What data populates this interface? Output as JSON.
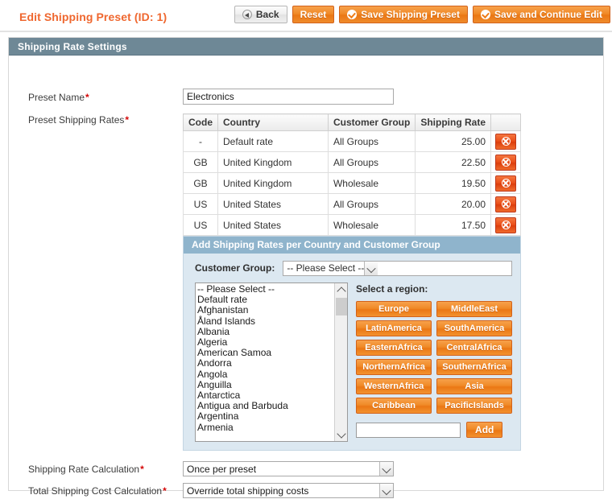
{
  "header": {
    "title": "Edit Shipping Preset (ID: 1)",
    "buttons": {
      "back": "Back",
      "reset": "Reset",
      "save": "Save Shipping Preset",
      "save_continue": "Save and Continue Edit"
    }
  },
  "section": {
    "title": "Shipping Rate Settings"
  },
  "fields": {
    "preset_name_label": "Preset Name",
    "preset_name_value": "Electronics",
    "preset_rates_label": "Preset Shipping Rates",
    "rate_calc_label": "Shipping Rate Calculation",
    "rate_calc_value": "Once per preset",
    "total_cost_label": "Total Shipping Cost Calculation",
    "total_cost_value": "Override total shipping costs",
    "required_mark": "*"
  },
  "rates_table": {
    "columns": [
      "Code",
      "Country",
      "Customer Group",
      "Shipping Rate",
      ""
    ],
    "rows": [
      {
        "code": "-",
        "country": "Default rate",
        "group": "All Groups",
        "rate": "25.00"
      },
      {
        "code": "GB",
        "country": "United Kingdom",
        "group": "All Groups",
        "rate": "22.50"
      },
      {
        "code": "GB",
        "country": "United Kingdom",
        "group": "Wholesale",
        "rate": "19.50"
      },
      {
        "code": "US",
        "country": "United States",
        "group": "All Groups",
        "rate": "20.00"
      },
      {
        "code": "US",
        "country": "United States",
        "group": "Wholesale",
        "rate": "17.50"
      }
    ]
  },
  "add_panel": {
    "title": "Add Shipping Rates per Country and Customer Group",
    "customer_group_label": "Customer Group:",
    "customer_group_value": "-- Please Select --",
    "country_list": [
      "-- Please Select --",
      "Default rate",
      "Afghanistan",
      "Åland Islands",
      "Albania",
      "Algeria",
      "American Samoa",
      "Andorra",
      "Angola",
      "Anguilla",
      "Antarctica",
      "Antigua and Barbuda",
      "Argentina",
      "Armenia"
    ],
    "region_title": "Select a region:",
    "regions": [
      "Europe",
      "MiddleEast",
      "LatinAmerica",
      "SouthAmerica",
      "EasternAfrica",
      "CentralAfrica",
      "NorthernAfrica",
      "SouthernAfrica",
      "WesternAfrica",
      "Asia",
      "Caribbean",
      "PacificIslands"
    ],
    "add_input_value": "",
    "add_button": "Add"
  },
  "colors": {
    "accent_orange": "#ee7c18",
    "section_header": "#6e8896",
    "panel_header": "#8fb4cc",
    "panel_bg": "#dce8f1",
    "required": "#d40707",
    "delete_red": "#dc3d0c"
  }
}
